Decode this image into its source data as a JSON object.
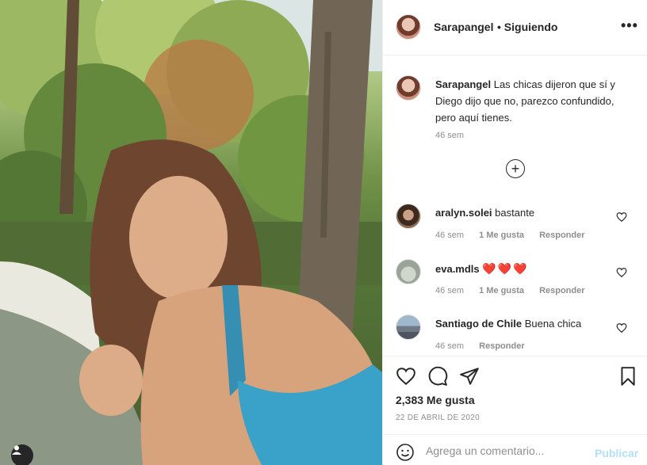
{
  "post": {
    "photo_alt": "",
    "author": "Sarapangel",
    "follow_status": "• Siguiendo",
    "more_icon": "more-horizontal-icon"
  },
  "caption": {
    "username": "Sarapangel",
    "text": "Las chicas dijeron que sí y Diego dijo que no, parezco confundido, pero aquí tienes.",
    "time": "46 sem"
  },
  "load_more_icon": "plus-circle-icon",
  "comments": [
    {
      "username": "aralyn.solei",
      "text": "bastante",
      "time": "46 sem",
      "likes": "1 Me gusta",
      "reply": "Responder"
    },
    {
      "username": "eva.mdls",
      "text": "❤️❤️❤️",
      "time": "46 sem",
      "likes": "1 Me gusta",
      "reply": "Responder"
    },
    {
      "username": "Santiago de Chile",
      "text": "Buena chica",
      "time": "46 sem",
      "likes": "",
      "reply": "Responder"
    }
  ],
  "actions": {
    "like_icon": "heart-icon",
    "comment_icon": "comment-icon",
    "share_icon": "send-icon",
    "save_icon": "bookmark-icon",
    "likes_count": "2,383 Me gusta",
    "date": "22 DE ABRIL DE 2020"
  },
  "add_comment": {
    "placeholder": "Agrega un comentario...",
    "post_label": "Publicar",
    "emoji_icon": "emoji-icon"
  },
  "colors": {
    "text": "#262626",
    "muted": "#8e8e8e",
    "heart": "#ed4956",
    "post_disabled": "#b2dffc",
    "border": "#efefef"
  }
}
